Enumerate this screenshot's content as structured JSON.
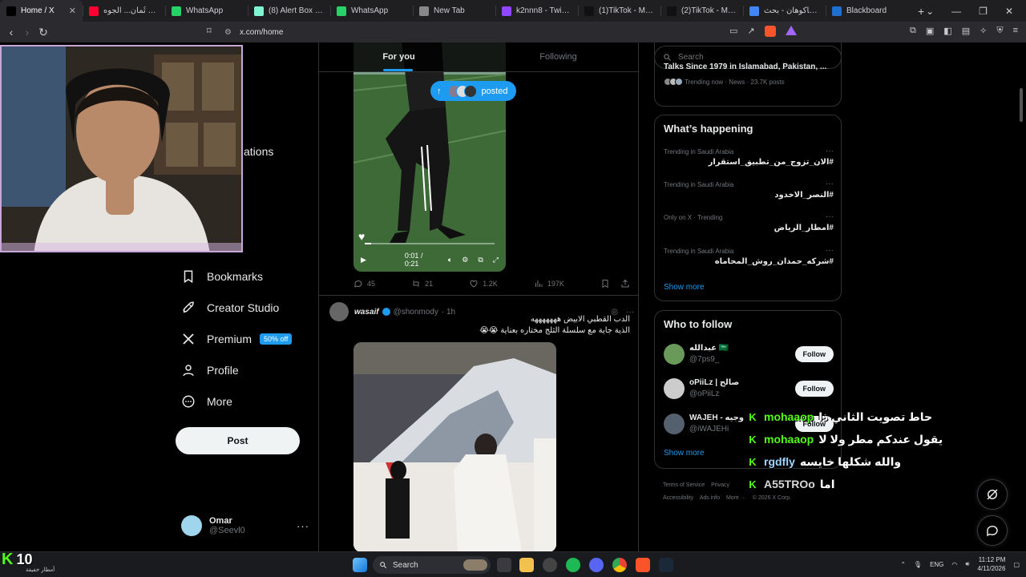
{
  "browser": {
    "tabs": [
      {
        "title": "Home / X",
        "icon": "x-icon",
        "color": "#000000",
        "active": true
      },
      {
        "title": "وصلت ثُمان... الجوه",
        "icon": "youtube-icon",
        "color": "#ff0033"
      },
      {
        "title": "WhatsApp",
        "icon": "whatsapp-icon",
        "color": "#25d366"
      },
      {
        "title": "(8) Alert Box / Stre",
        "icon": "streamlabs-icon",
        "color": "#80f5d2"
      },
      {
        "title": "WhatsApp",
        "icon": "whatsapp-icon",
        "color": "#25d366"
      },
      {
        "title": "New Tab",
        "icon": "brave-shield-icon",
        "color": "#888888"
      },
      {
        "title": "k2nnn8 - Twitch",
        "icon": "twitch-icon",
        "color": "#9146ff"
      },
      {
        "title": "(1)TikTok - Make Yo",
        "icon": "tiktok-icon",
        "color": "#111111"
      },
      {
        "title": "(2)TikTok - Make Yo",
        "icon": "tiktok-icon",
        "color": "#111111"
      },
      {
        "title": "باكوهان - بحث Google",
        "icon": "google-icon",
        "color": "#4285f4"
      },
      {
        "title": "Blackboard",
        "icon": "blackboard-icon",
        "color": "#1f6fd1"
      }
    ],
    "new_tab": "+",
    "url": "x.com/home"
  },
  "nav": {
    "partial_label": "ations",
    "items": [
      {
        "label": "Bookmarks",
        "icon": "bookmark-icon"
      },
      {
        "label": "Creator Studio",
        "icon": "rocket-icon"
      },
      {
        "label": "Premium",
        "icon": "x-logo-icon",
        "badge": "50% off"
      },
      {
        "label": "Profile",
        "icon": "person-icon"
      },
      {
        "label": "More",
        "icon": "more-circle-icon"
      }
    ],
    "post_button": "Post",
    "account": {
      "name": "Omar",
      "handle": "@Seevl0"
    }
  },
  "timeline": {
    "tabs": [
      "For you",
      "Following"
    ],
    "posted_pill": "posted",
    "video": {
      "time": "0:01 / 0:21",
      "progress": 0.05
    },
    "tweet1_actions": {
      "replies": "45",
      "reposts": "21",
      "likes": "1.2K",
      "views": "197K"
    },
    "tweet2": {
      "name": "wasaif",
      "handle": "@shonmody",
      "time": "· 1h",
      "text_line1": "الدب القطبي الابيض هههههههه",
      "text_line2": "الذية جاية مع سلسلة الثلج مختاره بعناية 😭😭"
    }
  },
  "sidebar_right": {
    "search_placeholder": "Search",
    "news": {
      "title": "Talks Since 1979 in Islamabad, Pakistan, ...",
      "meta": "Trending now · News · 23.7K posts"
    },
    "whats_happening": {
      "title": "What’s happening",
      "trends": [
        {
          "context": "Trending in Saudi Arabia",
          "tag": "#الان_تزوج_من_تطبيق_استقرار"
        },
        {
          "context": "Trending in Saudi Arabia",
          "tag": "#النصر_الاخدود"
        },
        {
          "context": "Only on X · Trending",
          "tag": "#امطار_الرياض"
        },
        {
          "context": "Trending in Saudi Arabia",
          "tag": "#شركه_حمدان_روش_المحاماه"
        }
      ],
      "show_more": "Show more"
    },
    "who_to_follow": {
      "title": "Who to follow",
      "accounts": [
        {
          "name": "عبدالله 🇸🇦",
          "handle": "@7ps9_",
          "button": "Follow"
        },
        {
          "name": "oPiiLz | صالح",
          "handle": "@oPiiLz",
          "button": "Follow"
        },
        {
          "name": "WAJEH - وجيه",
          "handle": "@iWAJEHi",
          "button": "Follow"
        }
      ],
      "show_more": "Show more"
    },
    "footer": [
      "Terms of Service",
      "Privacy",
      "Accessibility",
      "Ads info",
      "More ···",
      "© 2026 X Corp."
    ]
  },
  "chat_overlay": [
    {
      "user": "mohaaop",
      "msg": "حاط تصويت الثاني ذا"
    },
    {
      "user": "mohaaop",
      "msg": "يقول عندكم مطر ولا لا"
    },
    {
      "user": "rgdfly",
      "msg": "والله شكلها خايسه"
    },
    {
      "user": "A55TROo",
      "msg": "اما"
    }
  ],
  "stream_badge": {
    "count": "10",
    "caption": "أمطار خفيفة"
  },
  "taskbar": {
    "search": "Search",
    "lang": "ENG",
    "time": "11:12 PM",
    "date": "4/11/2026"
  }
}
